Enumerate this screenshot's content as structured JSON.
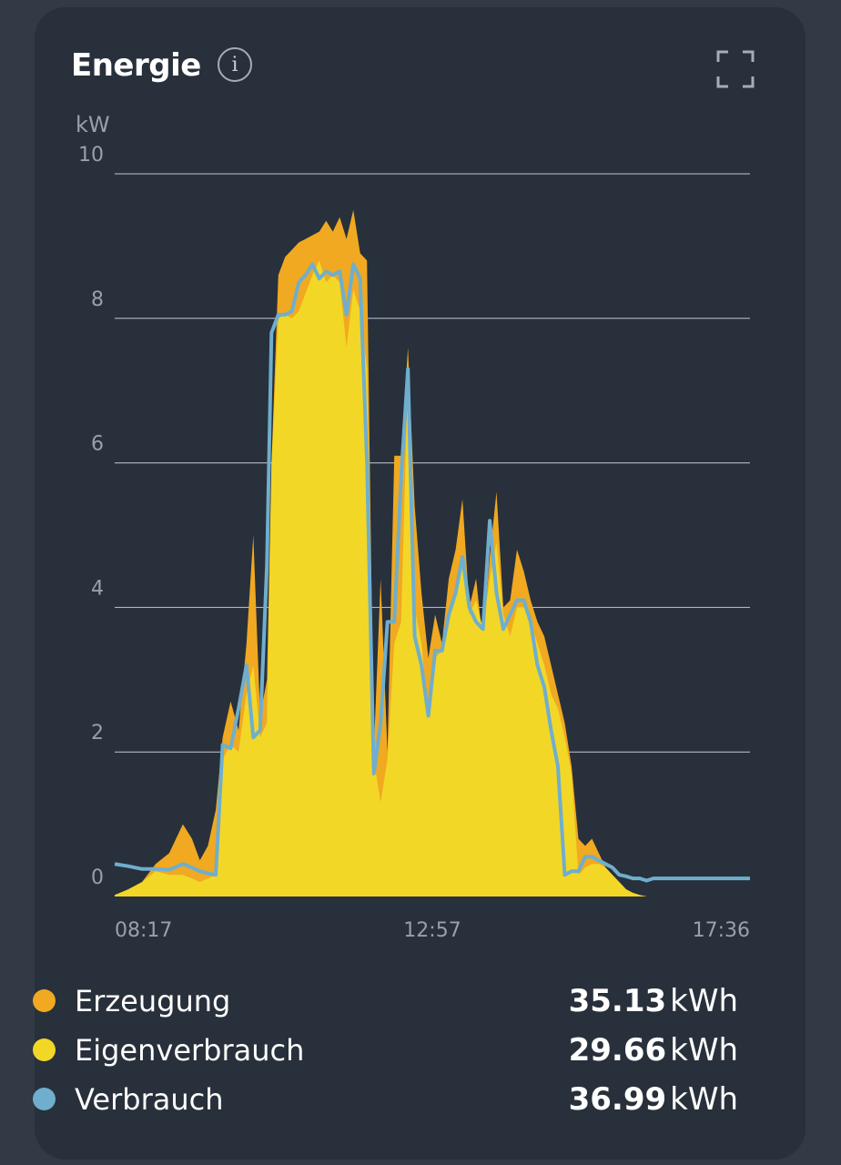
{
  "card": {
    "title": "Energie",
    "info_icon": "i"
  },
  "colors": {
    "background": "#323a45",
    "card": "#28303b",
    "erzeugung": "#f0a920",
    "eigenverbrauch": "#f3d727",
    "verbrauch": "#6faecd",
    "grid": "#c3c8cf",
    "tick": "#9aa0a8"
  },
  "legend": [
    {
      "label": "Erzeugung",
      "value": "35.13",
      "unit": "kWh",
      "color": "#f0a920"
    },
    {
      "label": "Eigenverbrauch",
      "value": "29.66",
      "unit": "kWh",
      "color": "#f3d727"
    },
    {
      "label": "Verbrauch",
      "value": "36.99",
      "unit": "kWh",
      "color": "#6faecd"
    }
  ],
  "chart_data": {
    "type": "area",
    "ylabel": "kW",
    "ylim": [
      0,
      10
    ],
    "yticks": [
      "10",
      "8",
      "6",
      "4",
      "2",
      "0"
    ],
    "xlim": [
      "08:17",
      "17:36"
    ],
    "xticks": [
      "08:17",
      "12:57",
      "17:36"
    ],
    "grid": true,
    "x_minutes_from_0817": [
      0,
      12,
      24,
      36,
      48,
      60,
      68,
      75,
      82,
      89,
      95,
      102,
      109,
      116,
      122,
      128,
      134,
      138,
      144,
      150,
      156,
      162,
      168,
      174,
      180,
      186,
      192,
      198,
      204,
      210,
      216,
      222,
      228,
      234,
      240,
      246,
      252,
      258,
      264,
      270,
      276,
      282,
      288,
      294,
      300,
      306,
      312,
      318,
      324,
      330,
      336,
      342,
      348,
      354,
      360,
      366,
      372,
      378,
      384,
      390,
      396,
      402,
      408,
      414,
      420,
      426,
      432,
      438,
      444,
      450,
      456,
      462,
      468,
      474,
      480,
      486,
      492,
      498,
      504,
      510,
      516,
      522,
      528,
      534,
      540,
      546,
      552,
      559
    ],
    "series": [
      {
        "name": "Erzeugung",
        "values": [
          0.02,
          0.1,
          0.2,
          0.45,
          0.6,
          1.0,
          0.8,
          0.5,
          0.7,
          1.2,
          2.2,
          2.7,
          2.3,
          3.5,
          5.0,
          2.5,
          3.0,
          6.0,
          8.6,
          8.85,
          8.95,
          9.05,
          9.1,
          9.15,
          9.2,
          9.35,
          9.2,
          9.4,
          9.1,
          9.5,
          8.9,
          8.8,
          2.0,
          4.4,
          2.0,
          6.1,
          6.1,
          7.6,
          5.4,
          4.2,
          3.3,
          3.9,
          3.5,
          4.4,
          4.8,
          5.5,
          4.0,
          4.4,
          3.5,
          4.7,
          5.6,
          4.0,
          4.1,
          4.8,
          4.5,
          4.1,
          3.8,
          3.6,
          3.2,
          2.8,
          2.4,
          1.8,
          0.8,
          0.7,
          0.8,
          0.6,
          0.4,
          0.3,
          0.2,
          0.1,
          0.05,
          0.02,
          0.0,
          0.0,
          0.0,
          0.0,
          0.0,
          0.0,
          0.0,
          0.0,
          0.0,
          0.0,
          0.0,
          0.0,
          0.0,
          0.0,
          0.0,
          0.0
        ]
      },
      {
        "name": "Eigenverbrauch",
        "values": [
          0.02,
          0.1,
          0.2,
          0.35,
          0.3,
          0.3,
          0.25,
          0.2,
          0.25,
          0.3,
          1.9,
          2.1,
          2.0,
          2.8,
          3.2,
          2.2,
          2.4,
          6.0,
          8.0,
          8.05,
          8.0,
          8.1,
          8.35,
          8.6,
          8.8,
          8.5,
          8.6,
          8.5,
          7.6,
          8.4,
          8.1,
          7.3,
          1.9,
          1.3,
          1.9,
          3.5,
          3.8,
          7.2,
          4.0,
          3.5,
          2.5,
          3.3,
          3.4,
          3.9,
          4.2,
          4.6,
          3.9,
          4.1,
          3.7,
          4.4,
          4.9,
          3.9,
          3.6,
          4.0,
          4.0,
          3.8,
          3.5,
          3.2,
          2.8,
          2.6,
          2.2,
          1.7,
          0.3,
          0.4,
          0.45,
          0.45,
          0.4,
          0.3,
          0.2,
          0.1,
          0.05,
          0.02,
          0.0,
          0.0,
          0.0,
          0.0,
          0.0,
          0.0,
          0.0,
          0.0,
          0.0,
          0.0,
          0.0,
          0.0,
          0.0,
          0.0,
          0.0,
          0.0
        ]
      },
      {
        "name": "Verbrauch",
        "values": [
          0.45,
          0.42,
          0.38,
          0.38,
          0.37,
          0.45,
          0.4,
          0.35,
          0.32,
          0.3,
          2.1,
          2.05,
          2.6,
          3.2,
          2.2,
          2.3,
          4.6,
          7.8,
          8.05,
          8.05,
          8.1,
          8.5,
          8.6,
          8.75,
          8.55,
          8.65,
          8.6,
          8.65,
          8.05,
          8.75,
          8.55,
          6.0,
          1.7,
          2.4,
          3.8,
          3.8,
          5.8,
          7.3,
          3.6,
          3.2,
          2.5,
          3.4,
          3.4,
          3.9,
          4.2,
          4.7,
          4.0,
          3.8,
          3.7,
          5.2,
          4.2,
          3.7,
          3.9,
          4.1,
          4.1,
          3.8,
          3.2,
          2.9,
          2.3,
          1.8,
          0.3,
          0.35,
          0.35,
          0.55,
          0.55,
          0.5,
          0.45,
          0.4,
          0.3,
          0.28,
          0.25,
          0.25,
          0.22,
          0.25,
          0.25,
          0.25,
          0.25,
          0.25,
          0.25,
          0.25,
          0.25,
          0.25,
          0.25,
          0.25,
          0.25,
          0.25,
          0.25,
          0.25
        ]
      }
    ]
  }
}
